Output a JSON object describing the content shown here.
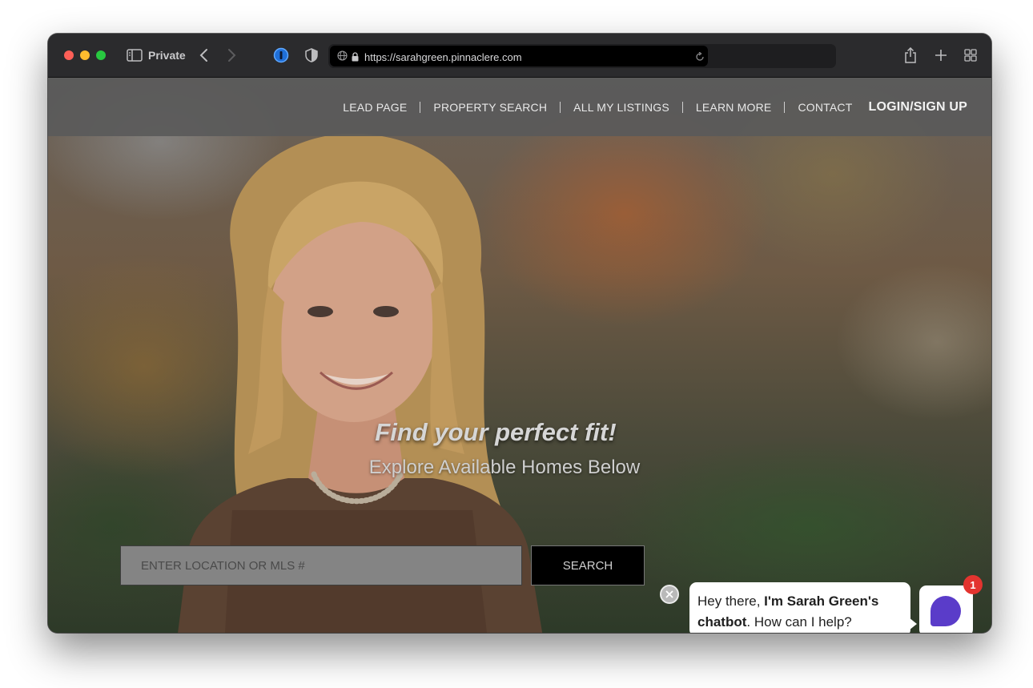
{
  "browser": {
    "mode_label": "Private",
    "url": "https://sarahgreen.pinnaclere.com"
  },
  "nav": {
    "items": [
      {
        "label": "LEAD PAGE"
      },
      {
        "label": "PROPERTY SEARCH"
      },
      {
        "label": "ALL MY LISTINGS"
      },
      {
        "label": "LEARN MORE"
      },
      {
        "label": "CONTACT"
      }
    ],
    "login_label": "LOGIN/SIGN UP"
  },
  "hero": {
    "headline": "Find your perfect fit!",
    "subheadline": "Explore Available Homes Below",
    "search_placeholder": "ENTER LOCATION OR MLS #",
    "search_button": "SEARCH"
  },
  "chatbot": {
    "greeting_prefix": "Hey there, ",
    "greeting_bold": "I'm Sarah Green's chatbot",
    "greeting_suffix": ". How can I help?",
    "badge_count": "1",
    "accent_color": "#5a3cc9",
    "badge_color": "#e3342f"
  },
  "icons": {
    "toolbar": [
      "sidebar-icon",
      "chevron-left-icon",
      "chevron-right-icon",
      "password-manager-icon",
      "shield-icon",
      "globe-icon",
      "lock-icon",
      "reload-icon",
      "share-icon",
      "plus-icon",
      "grid-icon"
    ],
    "chat": [
      "close-icon",
      "chat-bubble-icon"
    ]
  }
}
